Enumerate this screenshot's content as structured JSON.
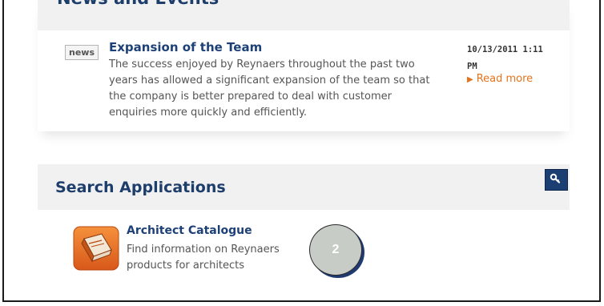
{
  "news": {
    "section_title": "News and Events",
    "item": {
      "badge": "news",
      "title": "Expansion of the Team",
      "body": "The success enjoyed by Reynaers throughout the past two years has allowed a significant expansion of the team so that the company is better prepared to deal with customer enquiries more quickly and efficiently.",
      "date_line1": "10/13/2011 1:11",
      "date_line2": "PM",
      "read_more": "Read more"
    }
  },
  "search": {
    "section_title": "Search Applications",
    "app": {
      "title": "Architect Catalogue",
      "description": "Find information on Reynaers products for architects",
      "icon": "catalogue-book-icon"
    },
    "search_icon": "search-key-icon"
  },
  "callout": {
    "number": "2"
  },
  "colors": {
    "title_blue": "#1d3d6b",
    "link_orange": "#e3731c",
    "panel_grey": "#f1f1f1",
    "button_navy": "#1b3f73"
  }
}
